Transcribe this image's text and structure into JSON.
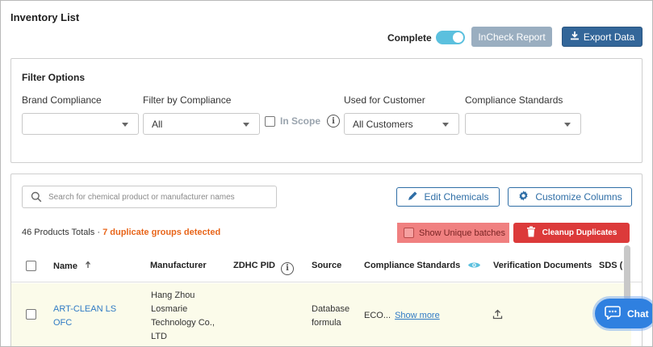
{
  "page": {
    "title": "Inventory List"
  },
  "header": {
    "complete_label": "Complete",
    "complete_on": true,
    "incheck_label": "InCheck Report",
    "export_label": "Export Data"
  },
  "filters": {
    "title": "Filter Options",
    "brand_compliance": {
      "label": "Brand Compliance",
      "value": ""
    },
    "filter_by_compliance": {
      "label": "Filter by Compliance",
      "value": "All"
    },
    "in_scope": {
      "label": "In Scope",
      "checked": false
    },
    "used_for_customer": {
      "label": "Used for Customer",
      "value": "All Customers"
    },
    "compliance_standards": {
      "label": "Compliance Standards",
      "value": ""
    }
  },
  "toolbar": {
    "search_placeholder": "Search for chemical product or manufacturer names",
    "edit_chemicals_label": "Edit Chemicals",
    "customize_columns_label": "Customize Columns"
  },
  "summary": {
    "totals": "46 Products Totals",
    "separator": " · ",
    "duplicates": "7 duplicate groups detected",
    "show_unique_label": "Show Unique batches",
    "cleanup_label": "Cleanup Duplicates"
  },
  "table": {
    "columns": {
      "name": "Name",
      "manufacturer": "Manufacturer",
      "zdhc_pid": "ZDHC PID",
      "source": "Source",
      "compliance_standards": "Compliance Standards",
      "verification_documents": "Verification Documents",
      "sds": "SDS ("
    },
    "rows": [
      {
        "name_line1": "ART-CLEAN LS",
        "name_line2": "OFC",
        "manufacturer_lines": [
          "Hang Zhou",
          "Losmarie",
          "Technology Co.,",
          "LTD"
        ],
        "zdhc_pid": "",
        "source_lines": [
          "Database",
          "formula"
        ],
        "compliance_short": "ECO...",
        "show_more": "Show more"
      }
    ]
  },
  "chat": {
    "label": "Chat"
  },
  "colors": {
    "primary": "#336699",
    "accent_teal": "#5bc0de",
    "danger": "#dc3a3a",
    "warning_text": "#e8651a",
    "link": "#2f7ac4",
    "row_highlight": "#fbfbea"
  }
}
